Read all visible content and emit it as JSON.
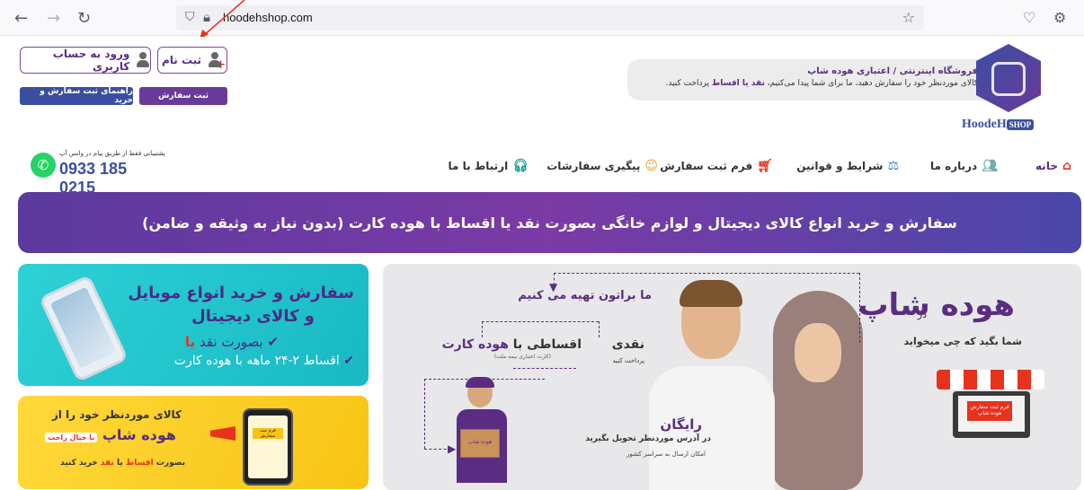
{
  "browser": {
    "url": "hoodehshop.com",
    "icons": [
      "back-arrow-icon",
      "forward-arrow-icon",
      "reload-icon",
      "shield-icon",
      "lock-icon",
      "star-icon",
      "pocket-icon",
      "extensions-icon"
    ]
  },
  "header": {
    "login_label": "ورود به حساب کاربری",
    "register_label": "ثبت نام",
    "order_button": "ثبت سفارش",
    "guide_button": "راهنمای ثبت سفارش و خرید",
    "info_title": "فروشگاه اینترنتی / اعتباری هوده شاپ",
    "info_desc_1": "کالای موردنظر خود را سفارش دهید، ما برای شما پیدا می‌کنیم،",
    "info_desc_bold": "نقد یا اقساط",
    "info_desc_2": "پرداخت کنید.",
    "logo_text": "HoodeH",
    "logo_shop": "SHOP"
  },
  "nav": {
    "items": [
      {
        "label": "خانه",
        "icon": "home-icon"
      },
      {
        "label": "درباره ما",
        "icon": "people-icon"
      },
      {
        "label": "شرایط و قوانین",
        "icon": "rules-icon"
      },
      {
        "label": "فرم ثبت سفارش",
        "icon": "cart-icon"
      },
      {
        "label": "پیگیری سفارشات",
        "icon": "smiley-icon"
      },
      {
        "label": "ارتباط با ما",
        "icon": "headset-icon"
      }
    ],
    "support_note": "پشتیبانی فقط از طریق پیام در واتس آپ",
    "phone": "0933 185 0215"
  },
  "hero": {
    "text": "سفارش و خرید انواع کالای دیجیتال و لوازم خانگی بصورت نقد یا اقساط با هوده کارت (بدون نیاز به وثیقه و ضامن)"
  },
  "card_phone": {
    "title": "سفارش و خرید انواع موبایل",
    "sub": "و کالای دیجیتال",
    "line1": "بصورت نقد",
    "line1_ya": "یا",
    "line2": "اقساط ۲-۲۴ ماهه با هوده کارت"
  },
  "card_yellow": {
    "l1": "کالای موردنظر خود را از",
    "l2": "هوده شاپ",
    "l2_tag": "با خیال راحت",
    "l3_a": "بصورت",
    "l3_b": "اقساط",
    "l3_c": "یا",
    "l3_d": "نقد",
    "l3_e": "خرید کنید",
    "screen_text": "فرم ثبت سفارش"
  },
  "card_main": {
    "dar": "در",
    "brand": "هوده شاپ",
    "ask": "شما بگید که چی میخواید",
    "we": "ما براتون تهیه می کنیم",
    "cash": "نقدی",
    "inst": "اقساطی با",
    "inst_card": "هوده کارت",
    "card_note": "(کارت اعتباری بیمه ملت)",
    "pay": "پرداخت کنید",
    "free": "رایگان",
    "deliver": "در آدرس موردنظر تحویل بگیرید",
    "ship": "امکان ارسال به سراسر کشور",
    "screen_form": "فرم ثبت سفارش",
    "screen_brand": "هوده شاپ",
    "box_text": "هوده شاپ"
  },
  "colors": {
    "brand_purple": "#5a2d82",
    "accent_red": "#e8331c",
    "teal": "#19b9c4",
    "yellow": "#f7c414"
  }
}
